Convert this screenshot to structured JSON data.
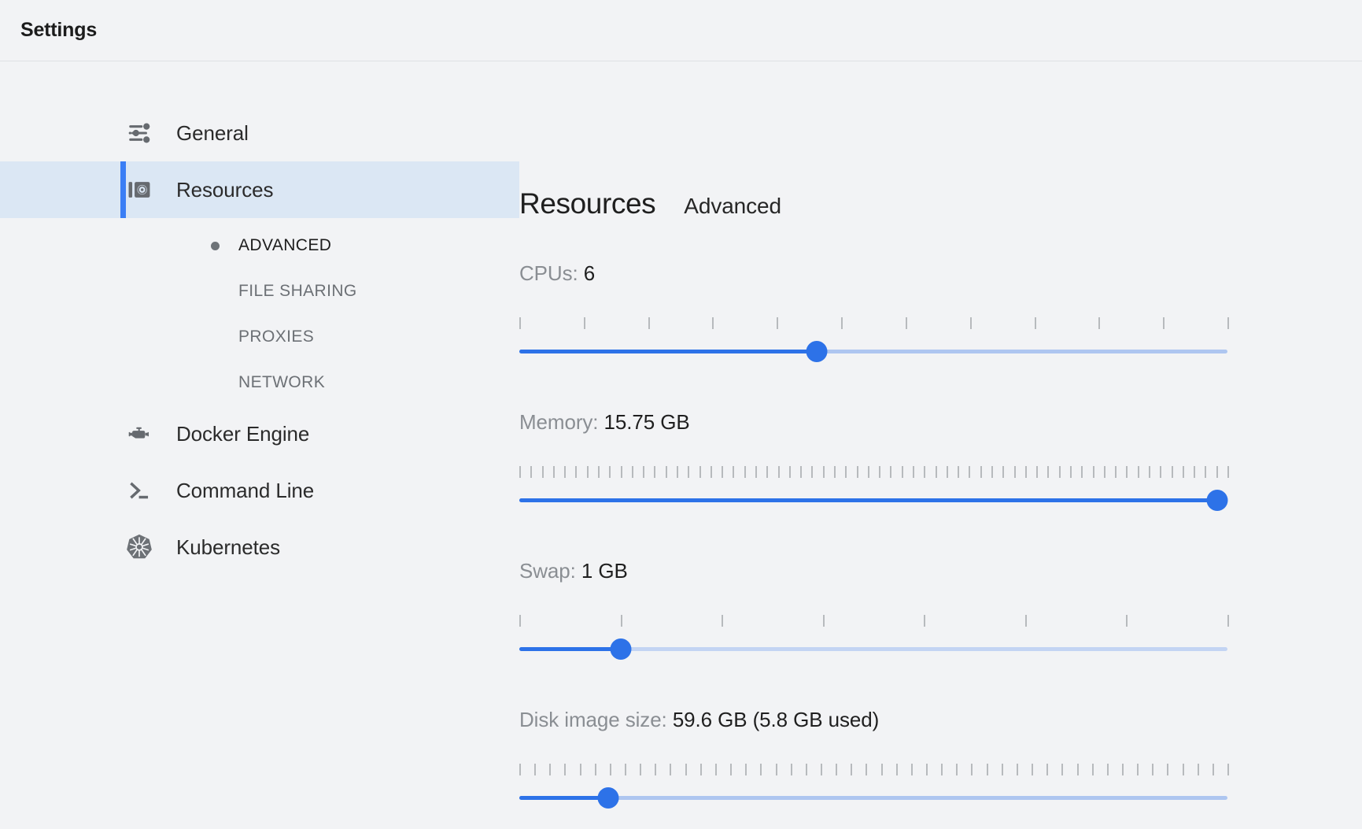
{
  "window": {
    "title": "Settings"
  },
  "sidebar": {
    "items": [
      {
        "label": "General",
        "icon": "tune-sliders-icon",
        "selected": false
      },
      {
        "label": "Resources",
        "icon": "resources-icon",
        "selected": true
      },
      {
        "label": "Docker Engine",
        "icon": "engine-icon",
        "selected": false
      },
      {
        "label": "Command Line",
        "icon": "terminal-prompt-icon",
        "selected": false
      },
      {
        "label": "Kubernetes",
        "icon": "kubernetes-helm-icon",
        "selected": false
      }
    ],
    "subitems": [
      {
        "label": "ADVANCED",
        "active": true
      },
      {
        "label": "FILE SHARING",
        "active": false
      },
      {
        "label": "PROXIES",
        "active": false
      },
      {
        "label": "NETWORK",
        "active": false
      }
    ]
  },
  "main": {
    "title": "Resources",
    "subtitle": "Advanced",
    "sliders": [
      {
        "name": "cpus",
        "label_prefix": "CPUs: ",
        "value_text": "6",
        "percent": 42,
        "tick_count": 12,
        "track_color": "#2d72e8",
        "rail_color": "#aec6f0"
      },
      {
        "name": "memory",
        "label_prefix": "Memory: ",
        "value_text": "15.75 GB",
        "percent": 98.5,
        "tick_count": 64,
        "track_color": "#2d72e8",
        "rail_color": "#aec6f0"
      },
      {
        "name": "swap",
        "label_prefix": "Swap: ",
        "value_text": "1 GB",
        "percent": 14.3,
        "tick_count": 8,
        "track_color": "#2d72e8",
        "rail_color": "#c3d4f3"
      },
      {
        "name": "disk-image-size",
        "label_prefix": "Disk image size: ",
        "value_text": "59.6 GB (5.8 GB used)",
        "percent": 12.5,
        "tick_count": 48,
        "track_color": "#2d72e8",
        "rail_color": "#aec6f0"
      }
    ]
  },
  "colors": {
    "accent": "#2d72e8",
    "selection_bar": "#3a7ef5",
    "selection_bg": "#dbe7f4",
    "background": "#f2f3f5",
    "text_primary": "#1f1f1f",
    "text_muted": "#8a8e93"
  }
}
